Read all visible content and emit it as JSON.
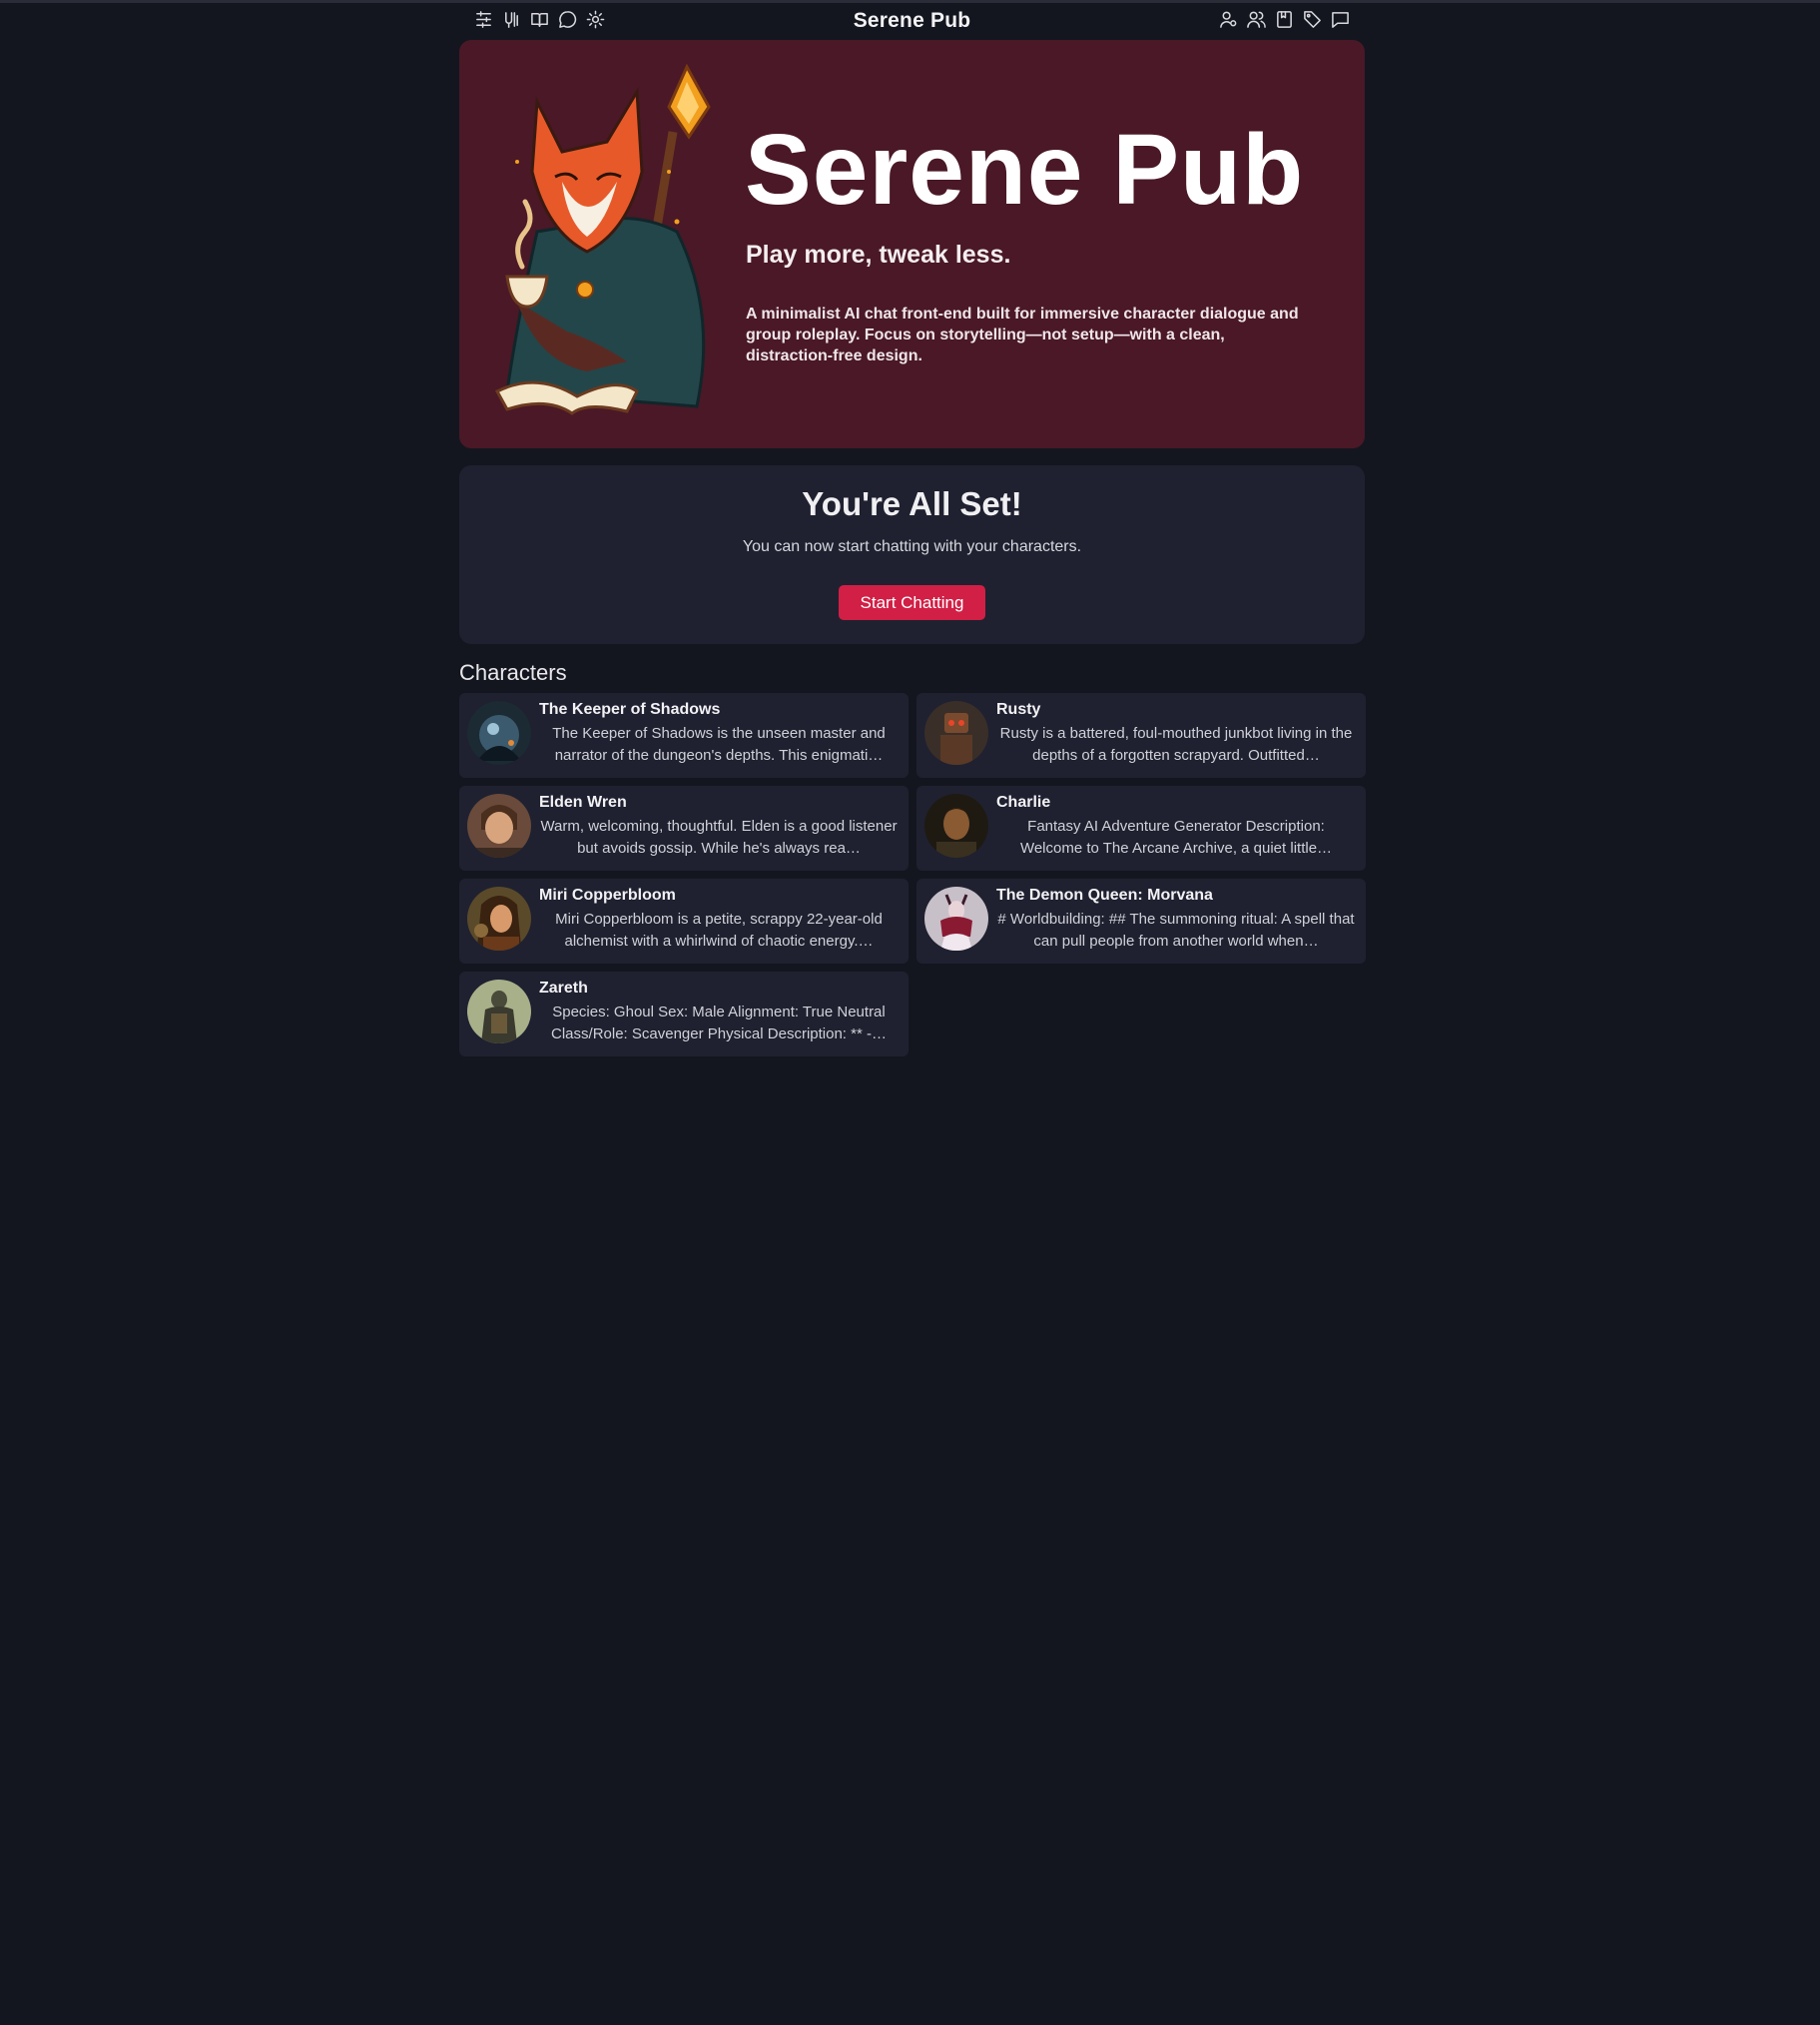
{
  "header": {
    "title": "Serene Pub",
    "left_icons": [
      "sliders-icon",
      "model-settings-icon",
      "book-icon",
      "chat-bubble-icon",
      "gear-icon"
    ],
    "right_icons": [
      "user-persona-icon",
      "users-icon",
      "lorebook-icon",
      "tag-icon",
      "chats-icon"
    ]
  },
  "hero": {
    "title": "Serene Pub",
    "tagline": "Play more, tweak less.",
    "description": "A minimalist AI chat front-end built for immersive character dialogue and group roleplay. Focus on storytelling—not setup—with a clean, distraction-free design."
  },
  "setup": {
    "title": "You're All Set!",
    "text": "You can now start chatting with your characters.",
    "button_label": "Start Chatting"
  },
  "characters": {
    "heading": "Characters",
    "items": [
      {
        "name": "The Keeper of Shadows",
        "description": "The Keeper of Shadows is the unseen master and narrator of the dungeon's depths. This enigmati…"
      },
      {
        "name": "Rusty",
        "description": "Rusty is a battered, foul-mouthed junkbot living in the depths of a forgotten scrapyard. Outfitted…"
      },
      {
        "name": "Elden Wren",
        "description": "Warm, welcoming, thoughtful. Elden is a good listener but avoids gossip. While he's always rea…"
      },
      {
        "name": "Charlie",
        "description": "Fantasy AI Adventure Generator Description: Welcome to The Arcane Archive, a quiet little…"
      },
      {
        "name": "Miri Copperbloom",
        "description": "Miri Copperbloom is a petite, scrappy 22-year-old alchemist with a whirlwind of chaotic energy.…"
      },
      {
        "name": "The Demon Queen: Morvana",
        "description": "# Worldbuilding: ## The summoning ritual: A spell that can pull people from another world when…"
      },
      {
        "name": "Zareth",
        "description": "Species: Ghoul Sex: Male Alignment: True Neutral Class/Role: Scavenger Physical Description: ** -…"
      }
    ]
  },
  "colors": {
    "background": "#14161f",
    "hero_bg": "#4a1826",
    "card_bg": "#1f2130",
    "accent": "#d11f45"
  }
}
